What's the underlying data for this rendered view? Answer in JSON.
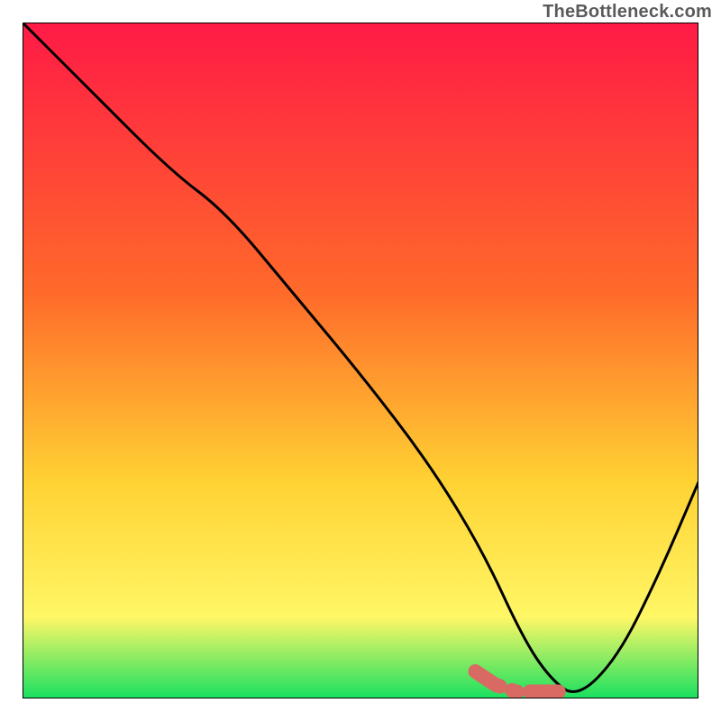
{
  "watermark": "TheBottleneck.com",
  "colors": {
    "gradient_top": "#ff1a46",
    "gradient_mid1": "#ff6a2a",
    "gradient_mid2": "#ffd233",
    "gradient_mid3": "#fff766",
    "gradient_bottom": "#18e060",
    "curve": "#000000",
    "marker": "#d96a63",
    "frame": "#000000"
  },
  "chart_data": {
    "type": "line",
    "title": "",
    "xlabel": "",
    "ylabel": "",
    "xlim": [
      0,
      100
    ],
    "ylim": [
      0,
      100
    ],
    "grid": false,
    "legend": false,
    "series": [
      {
        "name": "bottleneck-curve",
        "x": [
          0,
          10,
          22,
          30,
          40,
          50,
          60,
          68,
          74,
          78,
          82,
          88,
          94,
          100
        ],
        "values": [
          100,
          90,
          78,
          72,
          60,
          48,
          35,
          22,
          9,
          3,
          0,
          6,
          18,
          32
        ]
      },
      {
        "name": "optimal-marker",
        "x": [
          67,
          70,
          73,
          76,
          78,
          80
        ],
        "values": [
          4,
          2,
          1,
          1,
          1,
          1
        ]
      }
    ],
    "annotations": []
  }
}
